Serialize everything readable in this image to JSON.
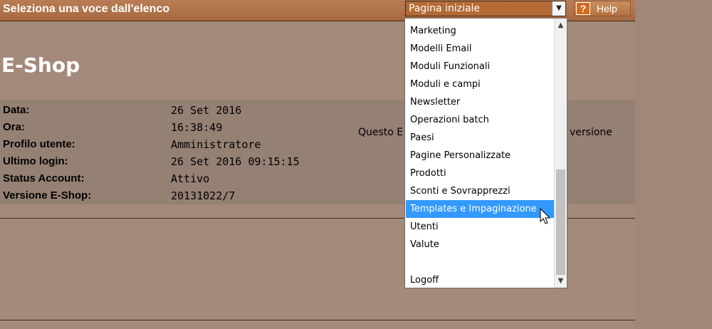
{
  "topbar": {
    "title": "Seleziona una voce dall'elenco",
    "select_value": "Pagina iniziale",
    "help_label": "Help",
    "help_icon": "question-mark-icon"
  },
  "page": {
    "title": "E-Shop"
  },
  "info": {
    "rows": [
      {
        "label": "Data:",
        "value": "26 Set 2016"
      },
      {
        "label": "Ora:",
        "value": "16:38:49"
      },
      {
        "label": "Profilo utente:",
        "value": "Amministratore"
      },
      {
        "label": "Ultimo login:",
        "value": "26 Set 2016 09:15:15"
      },
      {
        "label": "Status Account:",
        "value": "Attivo"
      },
      {
        "label": "Versione E-Shop:",
        "value": "20131022/7"
      }
    ],
    "message_left": "Questo E",
    "message_right": "versione"
  },
  "dropdown": {
    "items": [
      {
        "label": "Marketing"
      },
      {
        "label": "Modelli Email"
      },
      {
        "label": "Moduli Funzionali"
      },
      {
        "label": "Moduli e campi"
      },
      {
        "label": "Newsletter"
      },
      {
        "label": "Operazioni batch"
      },
      {
        "label": "Paesi"
      },
      {
        "label": "Pagine Personalizzate"
      },
      {
        "label": "Prodotti"
      },
      {
        "label": "Sconti e Sovrapprezzi"
      },
      {
        "label": "Templates e Impaginazione"
      },
      {
        "label": "Utenti"
      },
      {
        "label": "Valute"
      },
      {
        "label": ""
      },
      {
        "label": "Logoff"
      }
    ],
    "selected_index": 10
  },
  "colors": {
    "topbar": "#a8693f",
    "background": "#a48a7a",
    "panel": "#958074",
    "selection": "#3399ff"
  }
}
